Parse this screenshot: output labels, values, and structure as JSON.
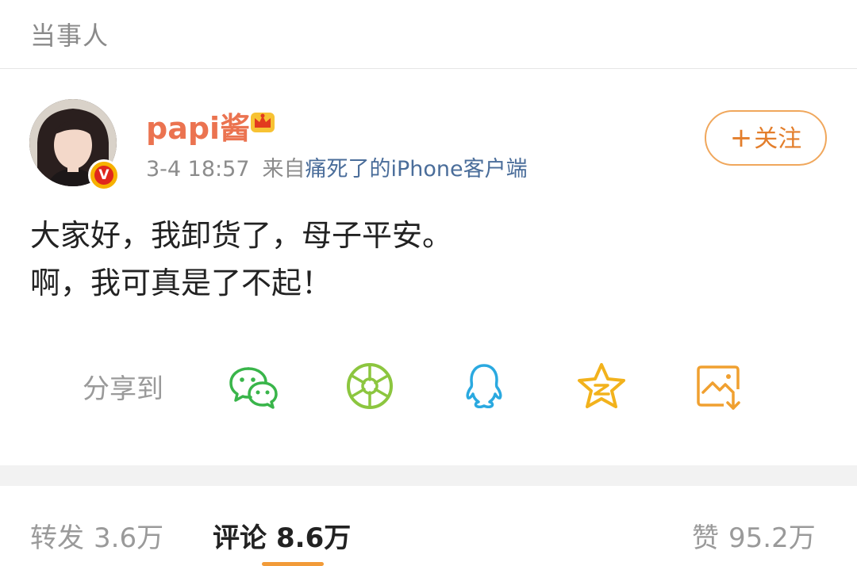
{
  "section": {
    "title": "当事人"
  },
  "post": {
    "username": "papi酱",
    "time": "3-4 18:57",
    "source_prefix": "来自",
    "source_app": "痛死了的iPhone客户端",
    "follow_label": "关注",
    "follow_plus": "+",
    "content_lines": [
      "大家好，我卸货了，母子平安。",
      "啊，我可真是了不起！"
    ],
    "verified_badge": "V"
  },
  "share": {
    "label": "分享到",
    "targets": [
      {
        "icon": "wechat-icon",
        "color": "#39b54a"
      },
      {
        "icon": "moments-icon",
        "color": "#8cc63f"
      },
      {
        "icon": "qq-icon",
        "color": "#2aa9e0"
      },
      {
        "icon": "qzone-icon",
        "color": "#f2b21c"
      },
      {
        "icon": "save-image-icon",
        "color": "#f0a030"
      }
    ]
  },
  "stats": {
    "repost": {
      "label": "转发",
      "value": "3.6万"
    },
    "comment": {
      "label": "评论",
      "value": "8.6万"
    },
    "like": {
      "label": "赞",
      "value": "95.2万"
    }
  },
  "colors": {
    "accent": "#eb7350",
    "link": "#4a6d9a",
    "tab_underline": "#f29b38"
  }
}
